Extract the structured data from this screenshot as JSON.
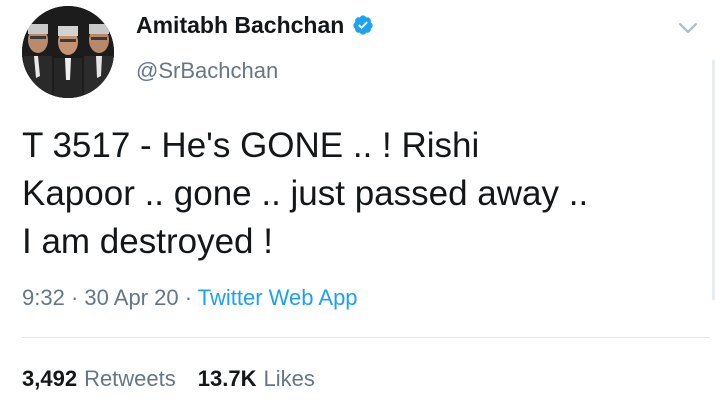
{
  "author": {
    "name": "Amitabh Bachchan",
    "handle": "@SrBachchan",
    "verified": true,
    "avatar_icon": "avatar-photo",
    "verified_icon": "verified-badge-icon"
  },
  "tweet": {
    "text": "T 3517 - He's GONE .. ! Rishi\nKapoor .. gone .. just passed away ..\nI am destroyed !",
    "time": "9:32",
    "date": "30 Apr 20",
    "separator": "·",
    "source": "Twitter Web App"
  },
  "stats": {
    "retweets_count": "3,492",
    "retweets_label": "Retweets",
    "likes_count": "13.7K",
    "likes_label": "Likes"
  },
  "colors": {
    "text": "#14171a",
    "secondary": "#657786",
    "accent": "#1da1f2",
    "divider": "#e1e8ed"
  }
}
